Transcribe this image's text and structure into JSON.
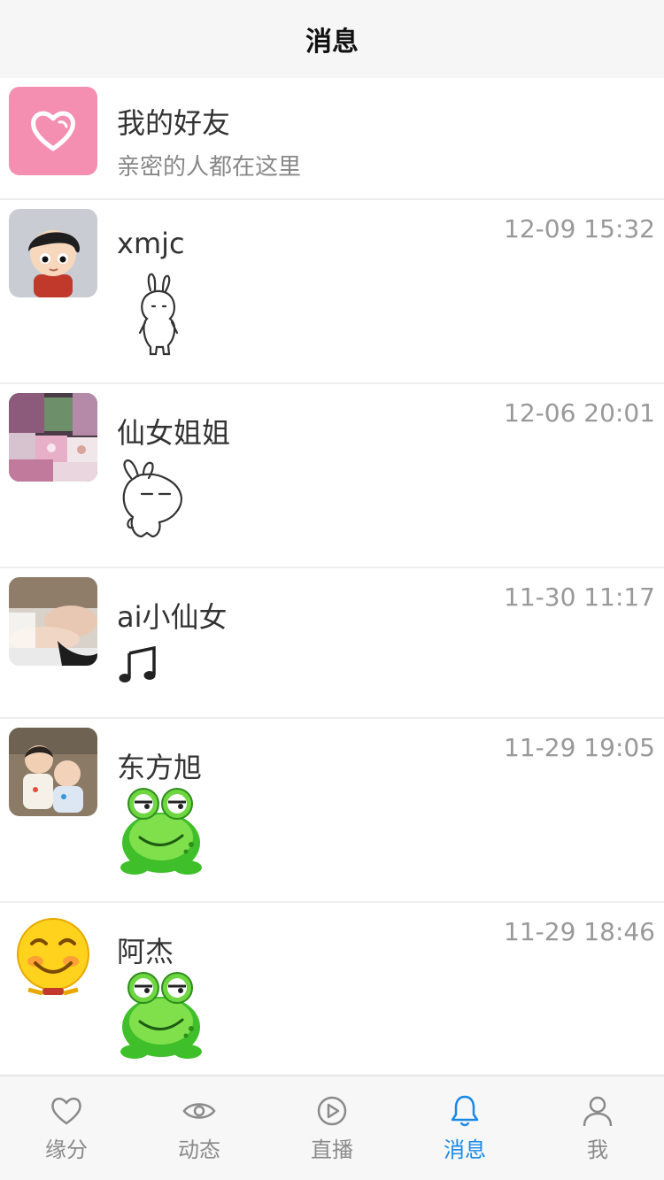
{
  "header": {
    "title": "消息"
  },
  "friends": {
    "title": "我的好友",
    "subtitle": "亲密的人都在这里",
    "icon": "heart-icon",
    "color": "#f48fb1"
  },
  "messages": [
    {
      "name": "xmjc",
      "time": "12-09 15:32",
      "avatar": "cartoon-boy-avatar",
      "preview": "rabbit-sticker"
    },
    {
      "name": "仙女姐姐",
      "time": "12-06 20:01",
      "avatar": "clothes-photo-avatar",
      "preview": "rabbit-sticker"
    },
    {
      "name": "ai小仙女",
      "time": "11-30 11:17",
      "avatar": "woman-photo-avatar",
      "preview": "music-note-icon"
    },
    {
      "name": "东方旭",
      "time": "11-29 19:05",
      "avatar": "children-photo-avatar",
      "preview": "frog-sticker"
    },
    {
      "name": "阿杰",
      "time": "11-29 18:46",
      "avatar": "smiley-avatar",
      "preview": "frog-sticker"
    }
  ],
  "tabs": [
    {
      "label": "缘分",
      "icon": "heart-outline-icon",
      "active": false
    },
    {
      "label": "动态",
      "icon": "eye-icon",
      "active": false
    },
    {
      "label": "直播",
      "icon": "play-circle-icon",
      "active": false
    },
    {
      "label": "消息",
      "icon": "bell-icon",
      "active": true
    },
    {
      "label": "我",
      "icon": "user-icon",
      "active": false
    }
  ],
  "colors": {
    "accent": "#1989e8",
    "tab_inactive": "#8a8a8a",
    "time": "#999999"
  }
}
